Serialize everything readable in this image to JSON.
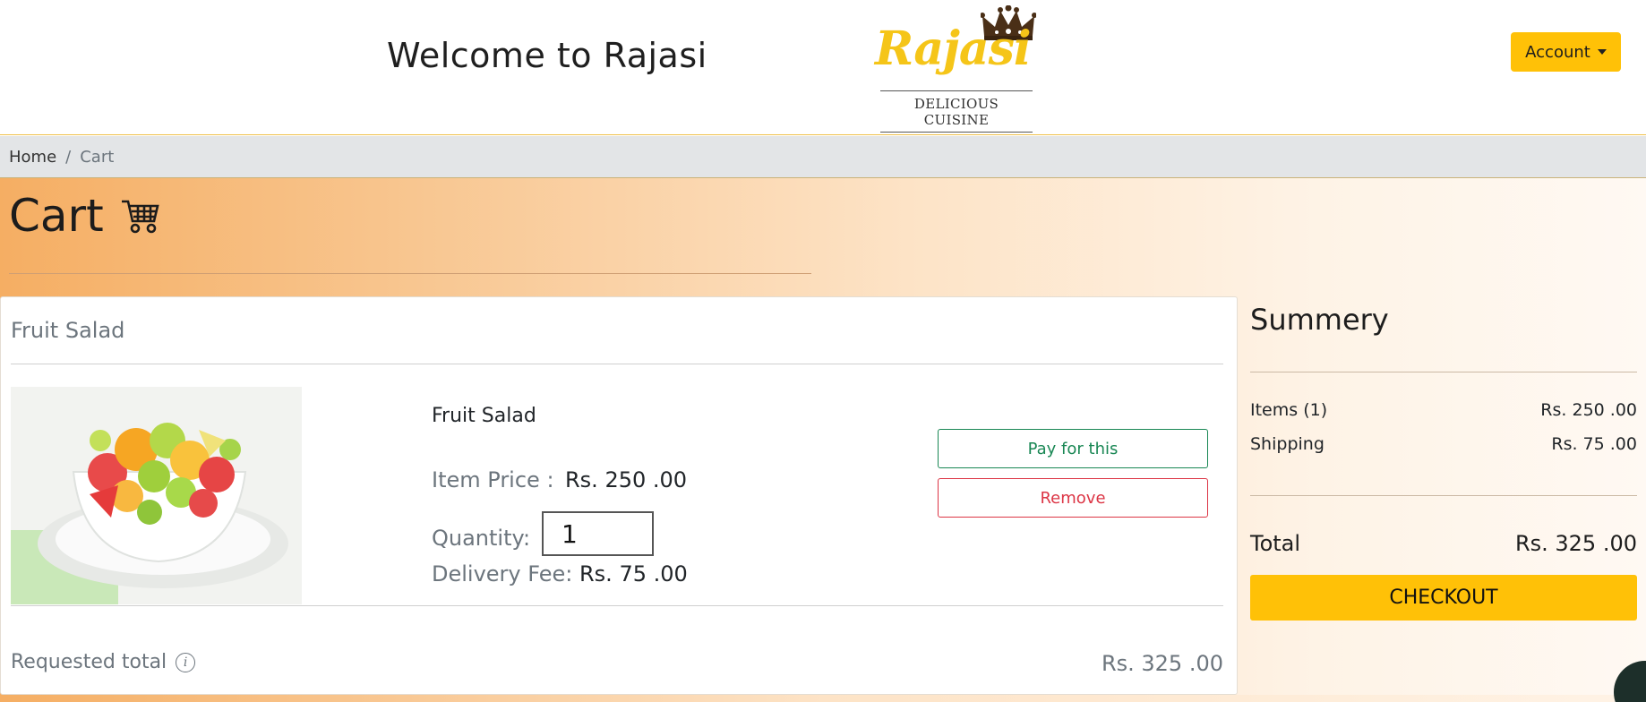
{
  "header": {
    "welcome_text": "Welcome to Rajasi",
    "logo": {
      "brand": "Rajasi",
      "tagline": "DELICIOUS CUISINE"
    },
    "account_label": "Account"
  },
  "breadcrumb": {
    "home": "Home",
    "separator": "/",
    "current": "Cart"
  },
  "page": {
    "title": "Cart",
    "title_icon": "shopping-cart-icon"
  },
  "cart_item": {
    "card_title": "Fruit Salad",
    "name": "Fruit Salad",
    "item_price_label": "Item Price :",
    "item_price_value": "Rs. 250 .00",
    "quantity_label": "Quantity:",
    "quantity_value": "1",
    "delivery_fee_label": "Delivery Fee:",
    "delivery_fee_value": "Rs. 75 .00",
    "pay_button": "Pay for this",
    "remove_button": "Remove",
    "requested_total_label": "Requested total",
    "requested_total_value": "Rs. 325 .00"
  },
  "summary": {
    "title": "Summery",
    "items_label": "Items (1)",
    "items_value": "Rs. 250 .00",
    "shipping_label": "Shipping",
    "shipping_value": "Rs. 75 .00",
    "total_label": "Total",
    "total_value": "Rs. 325 .00",
    "checkout_button": "CHECKOUT"
  },
  "colors": {
    "accent": "#ffc107",
    "gradient_start": "#f5ae63",
    "pay": "#198754",
    "remove": "#dc3545"
  }
}
